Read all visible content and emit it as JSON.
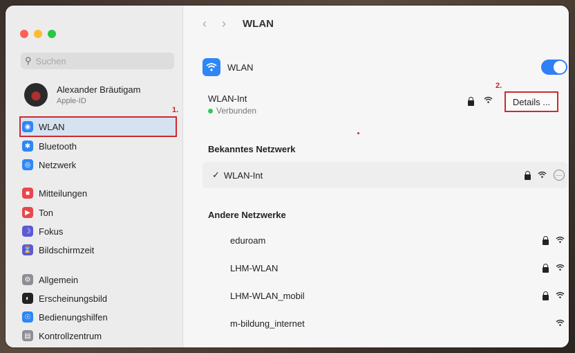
{
  "sidebar": {
    "search_placeholder": "Suchen",
    "profile": {
      "name": "Alexander Bräutigam",
      "subtitle": "Apple-ID"
    },
    "annotation_1": "1.",
    "items": [
      {
        "label": "WLAN",
        "icon": "wifi-icon",
        "color": "#2f86f6",
        "selected": true
      },
      {
        "label": "Bluetooth",
        "icon": "bluetooth-icon",
        "color": "#2f86f6"
      },
      {
        "label": "Netzwerk",
        "icon": "globe-icon",
        "color": "#2f86f6"
      },
      {
        "label": "Mitteilungen",
        "icon": "bell-icon",
        "color": "#e8474b"
      },
      {
        "label": "Ton",
        "icon": "speaker-icon",
        "color": "#e8474b"
      },
      {
        "label": "Fokus",
        "icon": "moon-icon",
        "color": "#5b5bd6"
      },
      {
        "label": "Bildschirmzeit",
        "icon": "hourglass-icon",
        "color": "#5b5bd6"
      },
      {
        "label": "Allgemein",
        "icon": "gear-icon",
        "color": "#8e8e93"
      },
      {
        "label": "Erscheinungsbild",
        "icon": "appearance-icon",
        "color": "#222222"
      },
      {
        "label": "Bedienungshilfen",
        "icon": "accessibility-icon",
        "color": "#2f86f6"
      },
      {
        "label": "Kontrollzentrum",
        "icon": "control-center-icon",
        "color": "#8e8e93"
      }
    ]
  },
  "header": {
    "title": "WLAN"
  },
  "wlan": {
    "label": "WLAN",
    "enabled": true,
    "current_network": "WLAN-Int",
    "status": "Verbunden",
    "details_label": "Details ...",
    "annotation_2": "2."
  },
  "known": {
    "heading": "Bekanntes Netzwerk",
    "checkmark": "✓",
    "network": "WLAN-Int",
    "more_symbol": "⋯"
  },
  "other": {
    "heading": "Andere Netzwerke",
    "networks": [
      {
        "name": "eduroam",
        "locked": true
      },
      {
        "name": "LHM-WLAN",
        "locked": true
      },
      {
        "name": "LHM-WLAN_mobil",
        "locked": true
      },
      {
        "name": "m-bildung_internet",
        "locked": false
      }
    ]
  },
  "colors": {
    "accent": "#2f7ff5",
    "annotation": "#cc2a2e",
    "connected": "#34c759"
  }
}
